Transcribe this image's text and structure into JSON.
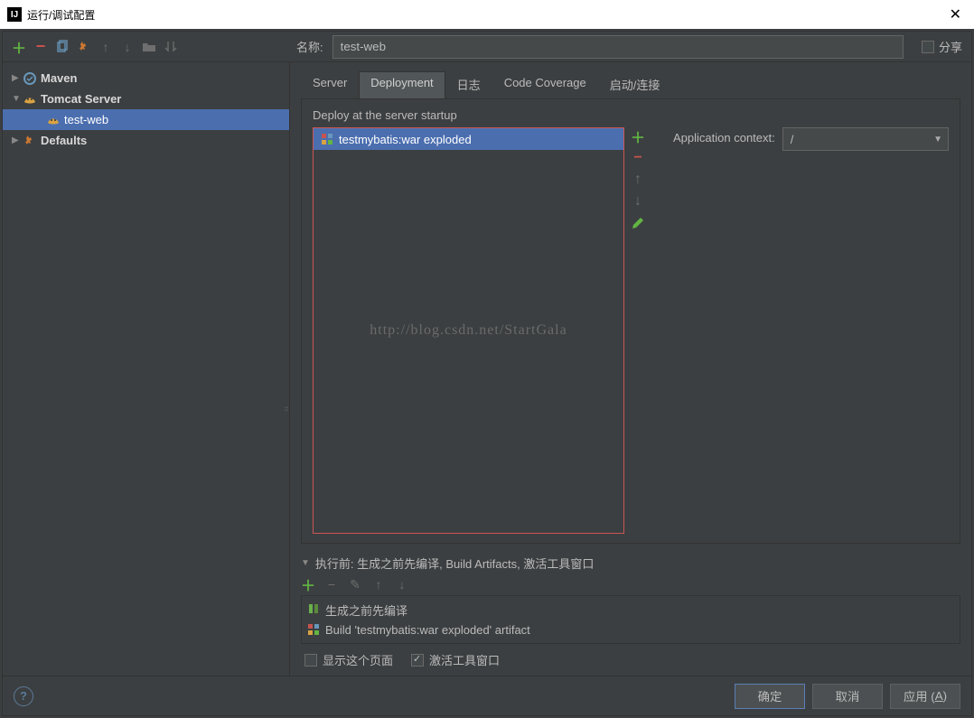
{
  "window": {
    "title": "运行/调试配置"
  },
  "toolbar": {
    "name_label": "名称:",
    "name_value": "test-web",
    "share_label": "分享"
  },
  "tree": {
    "maven": "Maven",
    "tomcat": "Tomcat Server",
    "testweb": "test-web",
    "defaults": "Defaults"
  },
  "tabs": {
    "server": "Server",
    "deployment": "Deployment",
    "logs": "日志",
    "coverage": "Code Coverage",
    "startup": "启动/连接"
  },
  "deploy": {
    "section_label": "Deploy at the server startup",
    "artifact": "testmybatis:war exploded",
    "context_label": "Application context:",
    "context_value": "/"
  },
  "watermark": "http://blog.csdn.net/StartGala",
  "before": {
    "header": "执行前: 生成之前先编译, Build Artifacts, 激活工具窗口",
    "task1": "生成之前先编译",
    "task2": "Build 'testmybatis:war exploded' artifact",
    "show_page": "显示这个页面",
    "activate_tool": "激活工具窗口"
  },
  "buttons": {
    "ok": "确定",
    "cancel": "取消",
    "apply_prefix": "应用 (",
    "apply_mnemonic": "A",
    "apply_suffix": ")"
  }
}
